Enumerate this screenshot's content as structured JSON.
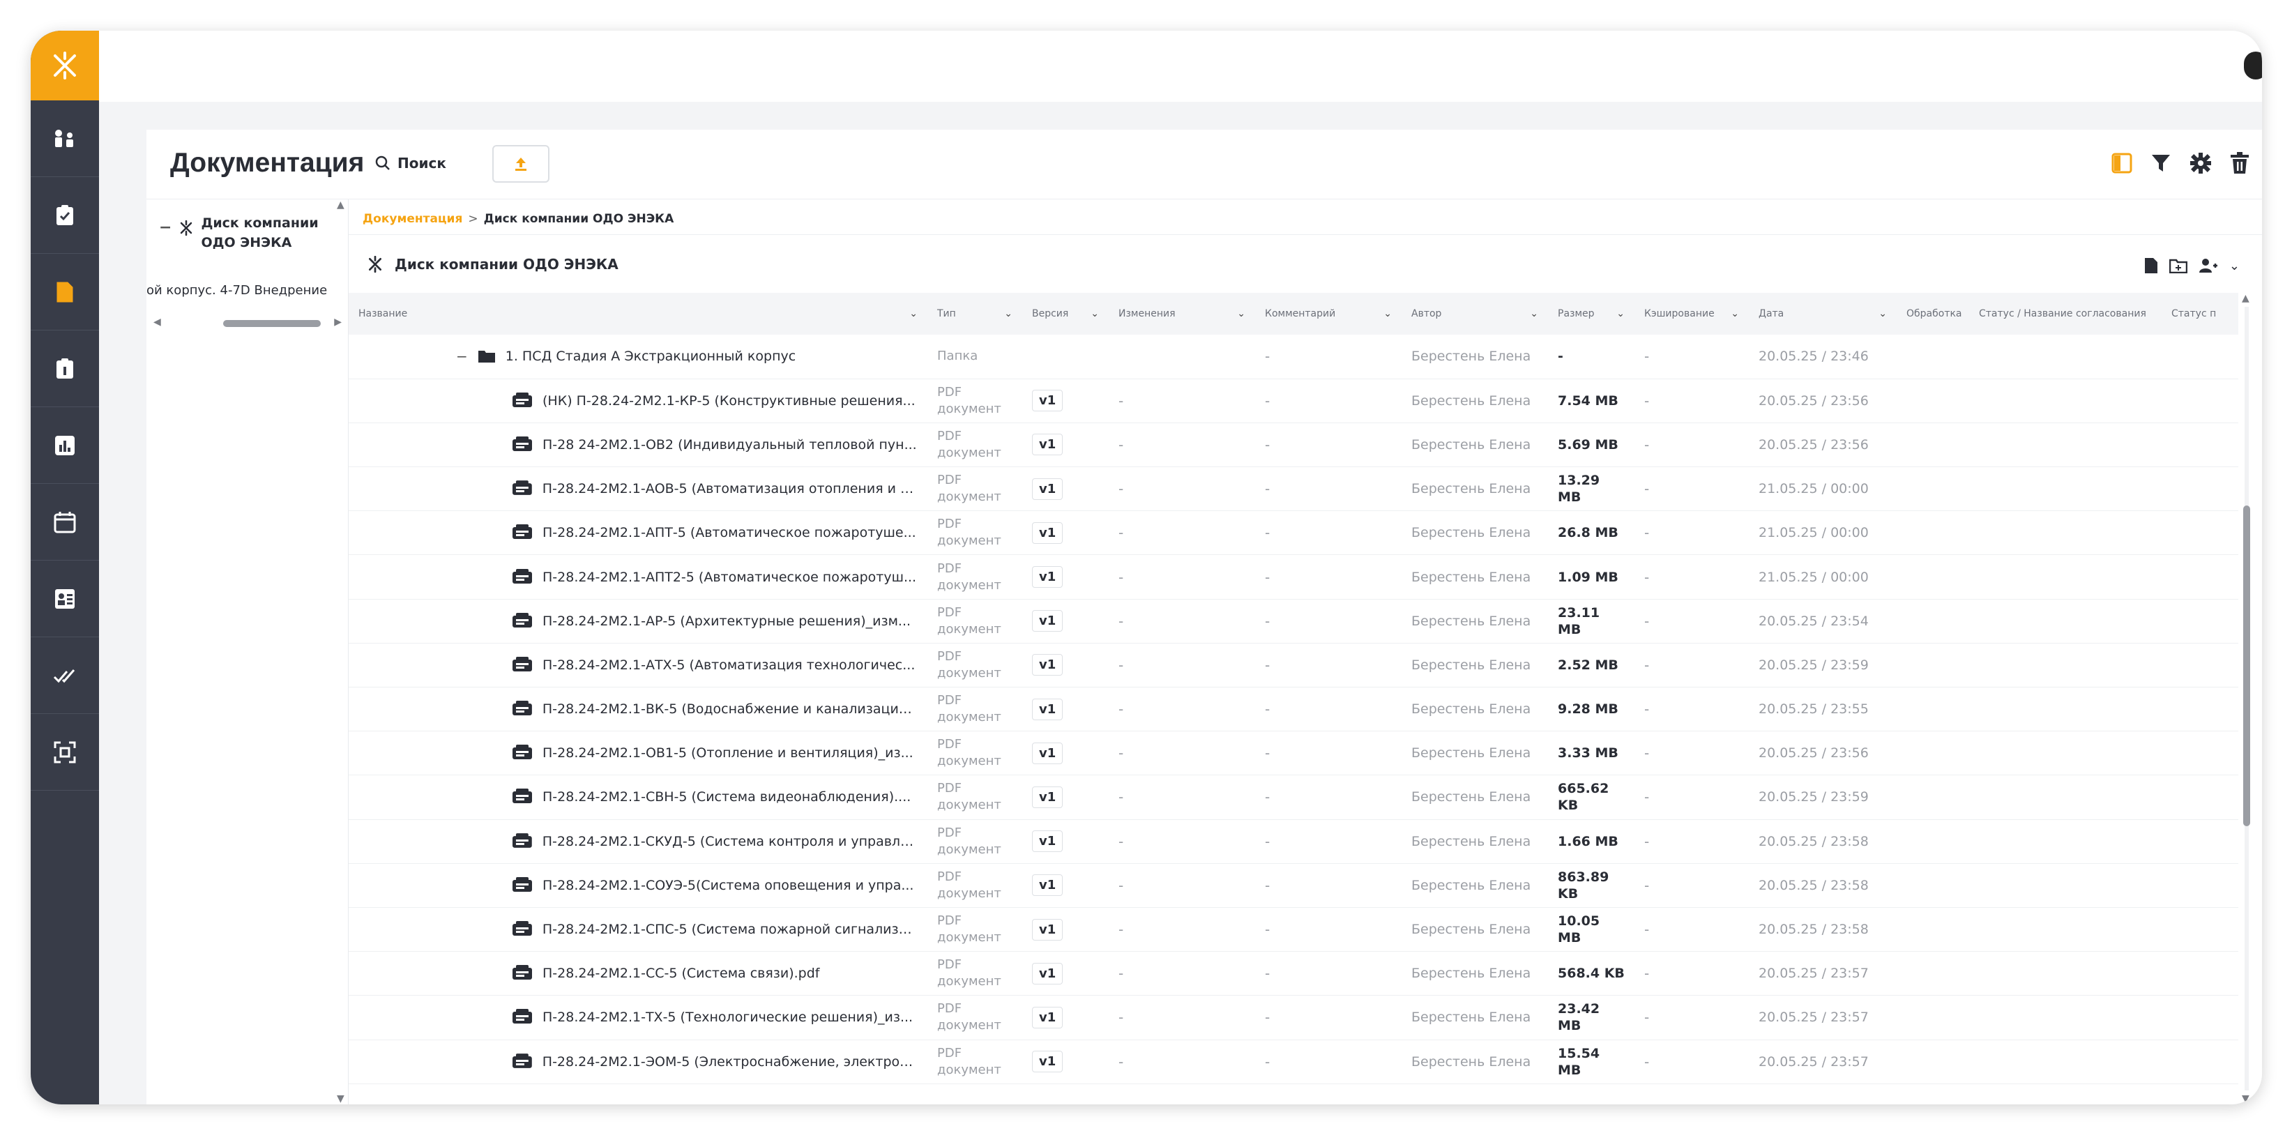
{
  "page": {
    "title": "Документация",
    "search_label": "Поиск"
  },
  "tree": {
    "root_label": "Диск компании ОДО ЭНЭКА",
    "sub_label": "ой корпус. 4-7D Внедрение"
  },
  "breadcrumb": {
    "home": "Документация",
    "separator": ">",
    "current": "Диск компании ОДО ЭНЭКА"
  },
  "folder": {
    "name": "Диск компании ОДО ЭНЭКА"
  },
  "columns": [
    {
      "label": "Название",
      "chevron": true
    },
    {
      "label": "Тип",
      "chevron": true
    },
    {
      "label": "Версия",
      "chevron": true
    },
    {
      "label": "Изменения",
      "chevron": true
    },
    {
      "label": "Комментарий",
      "chevron": true
    },
    {
      "label": "Автор",
      "chevron": true
    },
    {
      "label": "Размер",
      "chevron": true
    },
    {
      "label": "Кэширование",
      "chevron": true
    },
    {
      "label": "Дата",
      "chevron": true
    },
    {
      "label": "Обработка",
      "chevron": false
    },
    {
      "label": "Статус / Название согласования",
      "chevron": false
    },
    {
      "label": "Статус п",
      "chevron": false
    }
  ],
  "folder_row": {
    "name": "1. ПСД Стадия А Экстракционный корпус",
    "type": "Папка",
    "comment": "-",
    "author": "Берестень Елена",
    "size": "-",
    "cache": "-",
    "date": "20.05.25 / 23:46"
  },
  "files": [
    {
      "name": "(НК) П-28.24-2М2.1-КР-5 (Конструктивные решения...",
      "type": "PDF документ",
      "version": "v1",
      "changes": "-",
      "comment": "-",
      "author": "Берестень Елена",
      "size": "7.54 MB",
      "cache": "-",
      "date": "20.05.25 / 23:56"
    },
    {
      "name": "П-28 24-2М2.1-ОВ2 (Индивидуальный тепловой пун...",
      "type": "PDF документ",
      "version": "v1",
      "changes": "-",
      "comment": "-",
      "author": "Берестень Елена",
      "size": "5.69 MB",
      "cache": "-",
      "date": "20.05.25 / 23:56"
    },
    {
      "name": "П-28.24-2М2.1-АОВ-5 (Автоматизация отопления и в...",
      "type": "PDF документ",
      "version": "v1",
      "changes": "-",
      "comment": "-",
      "author": "Берестень Елена",
      "size": "13.29 MB",
      "cache": "-",
      "date": "21.05.25 / 00:00"
    },
    {
      "name": "П-28.24-2М2.1-АПТ-5 (Автоматическое пожаротуше...",
      "type": "PDF документ",
      "version": "v1",
      "changes": "-",
      "comment": "-",
      "author": "Берестень Елена",
      "size": "26.8 MB",
      "cache": "-",
      "date": "21.05.25 / 00:00"
    },
    {
      "name": "П-28.24-2М2.1-АПТ2-5 (Автоматическое пожаротуш...",
      "type": "PDF документ",
      "version": "v1",
      "changes": "-",
      "comment": "-",
      "author": "Берестень Елена",
      "size": "1.09 MB",
      "cache": "-",
      "date": "21.05.25 / 00:00"
    },
    {
      "name": "П-28.24-2М2.1-АР-5 (Архитектурные решения)_изм...",
      "type": "PDF документ",
      "version": "v1",
      "changes": "-",
      "comment": "-",
      "author": "Берестень Елена",
      "size": "23.11 MB",
      "cache": "-",
      "date": "20.05.25 / 23:54"
    },
    {
      "name": "П-28.24-2М2.1-АТХ-5 (Автоматизация технологичес...",
      "type": "PDF документ",
      "version": "v1",
      "changes": "-",
      "comment": "-",
      "author": "Берестень Елена",
      "size": "2.52 MB",
      "cache": "-",
      "date": "20.05.25 / 23:59"
    },
    {
      "name": "П-28.24-2М2.1-ВК-5 (Водоснабжение и канализация...",
      "type": "PDF документ",
      "version": "v1",
      "changes": "-",
      "comment": "-",
      "author": "Берестень Елена",
      "size": "9.28 MB",
      "cache": "-",
      "date": "20.05.25 / 23:55"
    },
    {
      "name": "П-28.24-2М2.1-ОВ1-5 (Отопление и вентиляция)_из...",
      "type": "PDF документ",
      "version": "v1",
      "changes": "-",
      "comment": "-",
      "author": "Берестень Елена",
      "size": "3.33 MB",
      "cache": "-",
      "date": "20.05.25 / 23:56"
    },
    {
      "name": "П-28.24-2М2.1-СВН-5 (Система видеонаблюдения)....",
      "type": "PDF документ",
      "version": "v1",
      "changes": "-",
      "comment": "-",
      "author": "Берестень Елена",
      "size": "665.62 KB",
      "cache": "-",
      "date": "20.05.25 / 23:59"
    },
    {
      "name": "П-28.24-2М2.1-СКУД-5 (Система контроля и управле...",
      "type": "PDF документ",
      "version": "v1",
      "changes": "-",
      "comment": "-",
      "author": "Берестень Елена",
      "size": "1.66 MB",
      "cache": "-",
      "date": "20.05.25 / 23:58"
    },
    {
      "name": "П-28.24-2М2.1-СОУЭ-5(Система оповещения и упра...",
      "type": "PDF документ",
      "version": "v1",
      "changes": "-",
      "comment": "-",
      "author": "Берестень Елена",
      "size": "863.89 KB",
      "cache": "-",
      "date": "20.05.25 / 23:58"
    },
    {
      "name": "П-28.24-2М2.1-СПС-5 (Система пожарной сигнализа...",
      "type": "PDF документ",
      "version": "v1",
      "changes": "-",
      "comment": "-",
      "author": "Берестень Елена",
      "size": "10.05 MB",
      "cache": "-",
      "date": "20.05.25 / 23:58"
    },
    {
      "name": "П-28.24-2М2.1-СС-5 (Система связи).pdf",
      "type": "PDF документ",
      "version": "v1",
      "changes": "-",
      "comment": "-",
      "author": "Берестень Елена",
      "size": "568.4 KB",
      "cache": "-",
      "date": "20.05.25 / 23:57"
    },
    {
      "name": "П-28.24-2М2.1-ТХ-5 (Технологические решения)_из...",
      "type": "PDF документ",
      "version": "v1",
      "changes": "-",
      "comment": "-",
      "author": "Берестень Елена",
      "size": "23.42 MB",
      "cache": "-",
      "date": "20.05.25 / 23:57"
    },
    {
      "name": "П-28.24-2М2.1-ЭОМ-5 (Электроснабжение, электроо...",
      "type": "PDF документ",
      "version": "v1",
      "changes": "-",
      "comment": "-",
      "author": "Берестень Елена",
      "size": "15.54 MB",
      "cache": "-",
      "date": "20.05.25 / 23:57"
    }
  ],
  "colors": {
    "accent": "#f5a413",
    "rail": "#383c48",
    "text": "#2a2d35",
    "muted": "#9b9ea4"
  },
  "icons": {
    "logo": "logo-icon",
    "file": "pdf-file-icon",
    "folder": "folder-icon"
  }
}
